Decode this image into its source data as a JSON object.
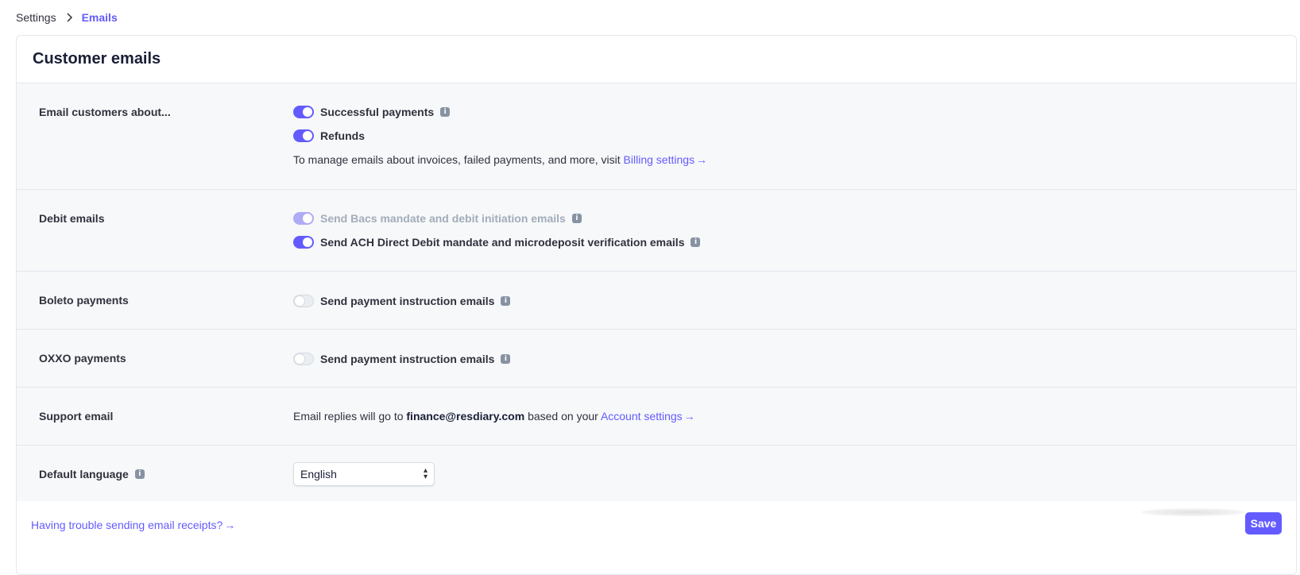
{
  "breadcrumb": {
    "parent": "Settings",
    "current": "Emails"
  },
  "card": {
    "title": "Customer emails"
  },
  "sections": {
    "email_customers": {
      "label": "Email customers about...",
      "toggles": [
        {
          "label": "Successful payments",
          "state": "on"
        },
        {
          "label": "Refunds",
          "state": "on"
        }
      ],
      "note_prefix": "To manage emails about invoices, failed payments, and more, visit",
      "note_link": "Billing settings"
    },
    "debit_emails": {
      "label": "Debit emails",
      "toggles": [
        {
          "label": "Send Bacs mandate and debit initiation emails",
          "state": "on-disabled"
        },
        {
          "label": "Send ACH Direct Debit mandate and microdeposit verification emails",
          "state": "on"
        }
      ]
    },
    "boleto": {
      "label": "Boleto payments",
      "toggle": {
        "label": "Send payment instruction emails",
        "state": "off"
      }
    },
    "oxxo": {
      "label": "OXXO payments",
      "toggle": {
        "label": "Send payment instruction emails",
        "state": "off"
      }
    },
    "support_email": {
      "label": "Support email",
      "prefix": "Email replies will go to",
      "email": "finance@resdiary.com",
      "middle": "based on your",
      "link": "Account settings"
    },
    "default_language": {
      "label": "Default language",
      "selected": "English"
    }
  },
  "footer": {
    "trouble_link": "Having trouble sending email receipts?",
    "save_label": "Save"
  },
  "colors": {
    "accent": "#635bff",
    "row_bg": "#f6f8fa",
    "border": "#e3e8ee"
  }
}
